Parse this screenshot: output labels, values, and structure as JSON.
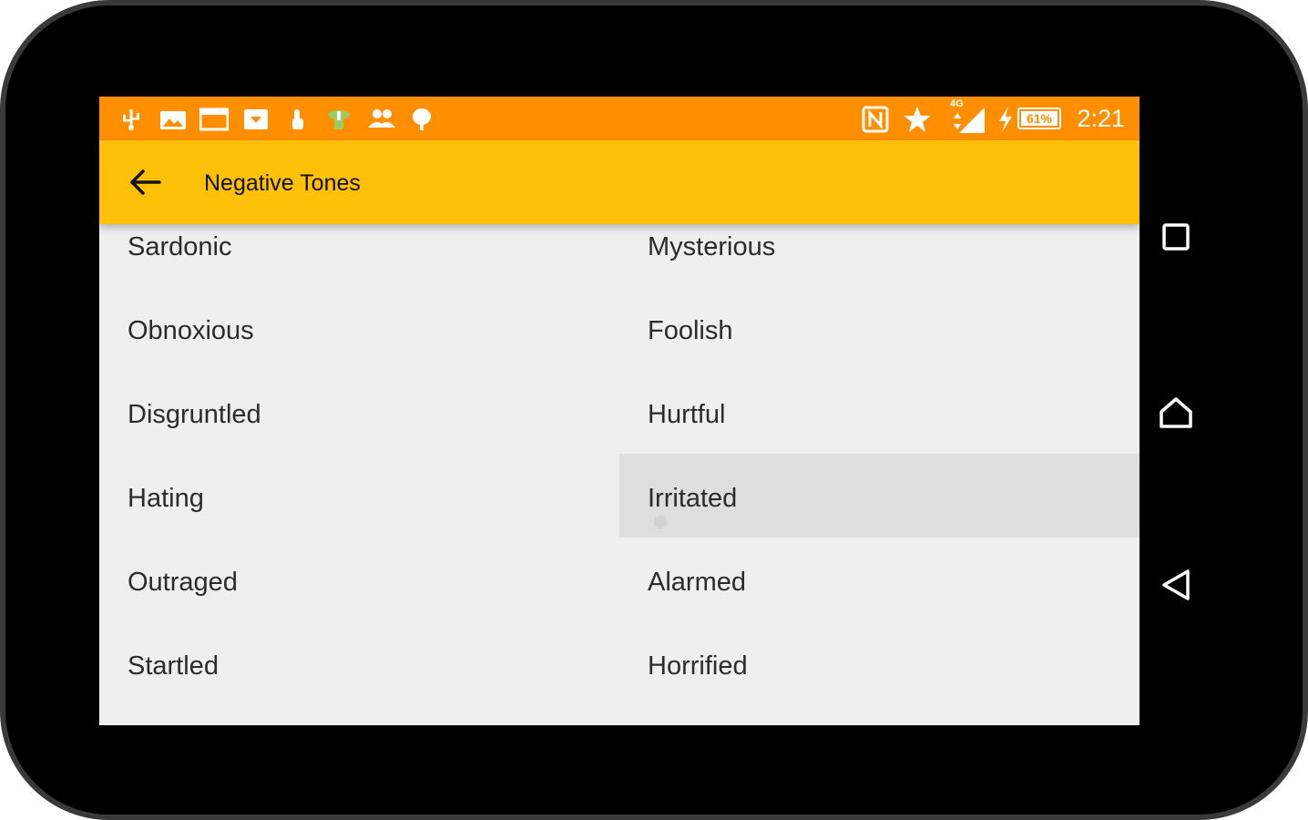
{
  "status_bar": {
    "time": "2:21",
    "battery_percent": "61%",
    "network_type": "4G",
    "notification_icons": [
      "usb-icon",
      "image-icon",
      "window-icon",
      "download-icon",
      "hand-icon",
      "android-update-icon",
      "contacts-icon",
      "android-icon"
    ],
    "system_icons": [
      "nfc-icon",
      "star-icon",
      "signal-icon",
      "charging-icon",
      "battery-icon"
    ],
    "color": "#ff8f00"
  },
  "app_bar": {
    "title": "Negative Tones",
    "back_icon": "arrow-back-icon",
    "color": "#ffc107"
  },
  "tones": {
    "items": [
      "Sardonic",
      "Mysterious",
      "Obnoxious",
      "Foolish",
      "Disgruntled",
      "Hurtful",
      "Hating",
      "Irritated",
      "Outraged",
      "Alarmed",
      "Startled",
      "Horrified"
    ],
    "pressed_item": "Irritated"
  },
  "nav_bar": {
    "buttons": [
      "recents-icon",
      "home-icon",
      "back-icon"
    ]
  }
}
